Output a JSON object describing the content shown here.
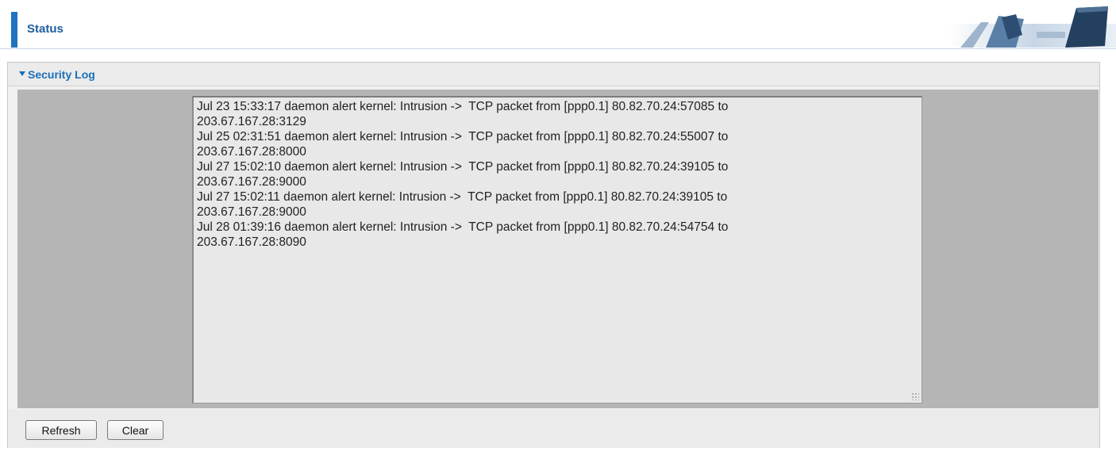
{
  "header": {
    "title": "Status"
  },
  "panel": {
    "title": "Security Log"
  },
  "log": {
    "lines": [
      "Jul 23 15:33:17 daemon alert kernel: Intrusion ->  TCP packet from [ppp0.1] 80.82.70.24:57085 to",
      "203.67.167.28:3129",
      "Jul 25 02:31:51 daemon alert kernel: Intrusion ->  TCP packet from [ppp0.1] 80.82.70.24:55007 to",
      "203.67.167.28:8000",
      "Jul 27 15:02:10 daemon alert kernel: Intrusion ->  TCP packet from [ppp0.1] 80.82.70.24:39105 to",
      "203.67.167.28:9000",
      "Jul 27 15:02:11 daemon alert kernel: Intrusion ->  TCP packet from [ppp0.1] 80.82.70.24:39105 to",
      "203.67.167.28:9000",
      "Jul 28 01:39:16 daemon alert kernel: Intrusion ->  TCP packet from [ppp0.1] 80.82.70.24:54754 to",
      "203.67.167.28:8090"
    ]
  },
  "buttons": {
    "refresh": "Refresh",
    "clear": "Clear"
  },
  "colors": {
    "accent": "#1f73c0",
    "title_text": "#1c5e9e",
    "log_background": "#b5b5b5"
  }
}
